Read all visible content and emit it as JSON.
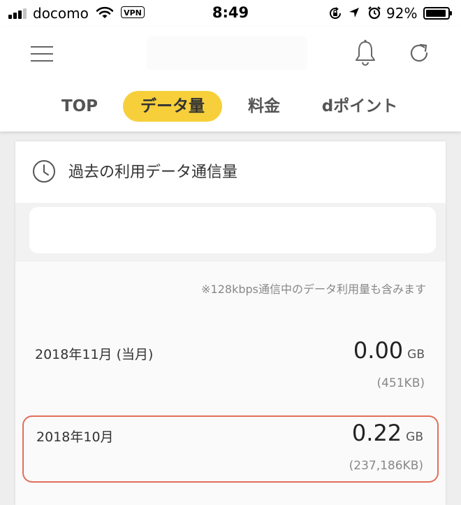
{
  "status_bar": {
    "carrier": "docomo",
    "vpn": "VPN",
    "time": "8:49",
    "battery_percent": "92%",
    "battery_level": 0.92,
    "signal_bars_filled": 3,
    "icons": [
      "signal-icon",
      "wifi-icon",
      "vpn-icon",
      "rotation-lock-icon",
      "location-icon",
      "alarm-icon",
      "battery-icon"
    ]
  },
  "header": {
    "icons": {
      "menu": "hamburger-menu-icon",
      "notifications": "bell-icon",
      "reload": "reload-icon"
    },
    "tabs": [
      {
        "label": "TOP",
        "active": false
      },
      {
        "label": "データ量",
        "active": true
      },
      {
        "label": "料金",
        "active": false
      },
      {
        "label": "dポイント",
        "active": false
      }
    ]
  },
  "card": {
    "title": "過去の利用データ通信量",
    "title_icon": "clock-icon",
    "note": "※128kbps通信中のデータ利用量も含みます",
    "rows": [
      {
        "month": "2018年11月 (当月)",
        "value": "0.00",
        "unit": "GB",
        "bytes": "(451KB)",
        "highlighted": false
      },
      {
        "month": "2018年10月",
        "value": "0.22",
        "unit": "GB",
        "bytes": "(237,186KB)",
        "highlighted": true
      }
    ]
  },
  "colors": {
    "accent": "#f6cf3b",
    "highlight_border": "#e26f58",
    "background": "#eeeeee"
  }
}
